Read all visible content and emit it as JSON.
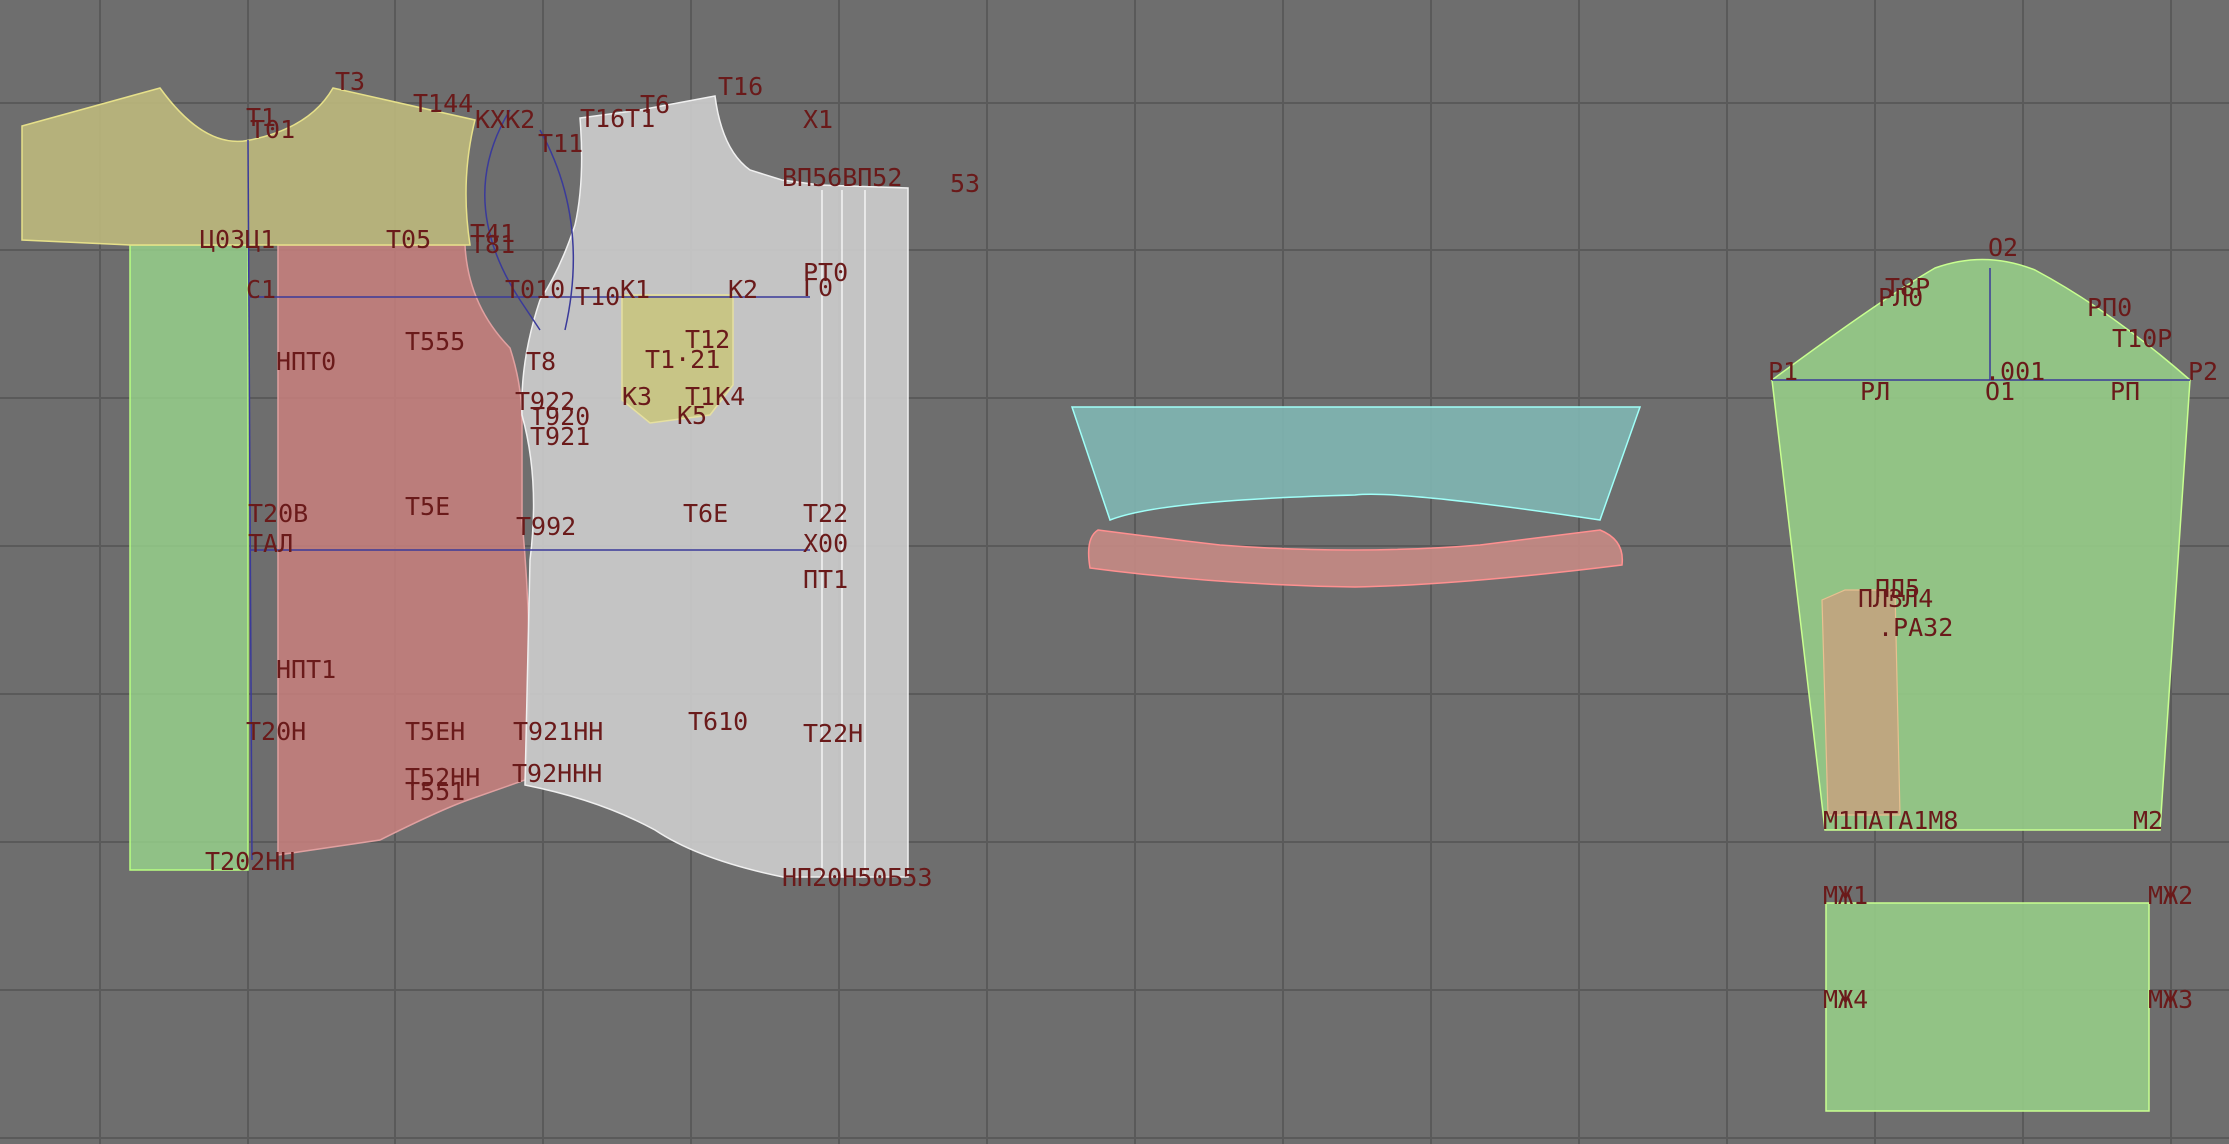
{
  "viewer": {
    "background": "#6e6e6e",
    "grid_color": "#5a5a5a",
    "pattern_colors": {
      "front_panel": "#c8c8c8",
      "side_panel": "#c9807e",
      "back_panel": "#98d68c",
      "yoke": "#bcb87c",
      "pocket": "#c9c57f",
      "collar_stand": "#7fb6b2",
      "collar_band": "#c58a84",
      "sleeve": "#94c786",
      "sleeve_placket": "#c9a07e",
      "cuff": "#94c786",
      "construction_line": "#3a3a9a",
      "label": "#6a1a1a"
    }
  },
  "labels": {
    "t3": "T3",
    "t1": "T1",
    "t01": "T01",
    "t44": "T144",
    "kk2": "KXK2",
    "t1611": "T16T1",
    "t6": "T6",
    "t16": "T16",
    "x1": "X1",
    "t11": "T11",
    "vp": "ВП56ВП52",
    "vp53": "53",
    "c03": "Ц03Ц1",
    "t05": "T05",
    "t41": "T41",
    "t81": "T81",
    "rt0": "РТ0",
    "c1": "C1",
    "t010": "T010",
    "t10": "T10",
    "k1": "K1",
    "k2": "K2",
    "g0": "Г0",
    "npt0": "НПТ0",
    "t555": "T555",
    "t12": "T12",
    "t8": "T8",
    "t121": "T1·21",
    "k3": "K3",
    "t1k4": "T1K4",
    "t922": "T922",
    "t920": "T920",
    "k5": "K5",
    "t921": "T921",
    "t20v": "T20B",
    "t5e": "T5E",
    "t992": "T992",
    "t6e": "T6E",
    "t22": "T22",
    "tal": "TAЛ",
    "x00": "X00",
    "pt1": "ПТ1",
    "npt1": "НПТ1",
    "t610": "T610",
    "t20n": "T20H",
    "t5en": "T5EH",
    "t921n": "T921HH",
    "t22n": "T22H",
    "t52nn": "T52HH",
    "t92nn": "T92HHH",
    "t551": "T551",
    "t202nn": "T202HH",
    "np": "НП20Н50Б53",
    "o2": "O2",
    "r8p": "T8P",
    "r10": "РЛ0",
    "rp0": "РП0",
    "t10r": "T10P",
    "r1": "P1",
    "rl": "РЛ",
    "o01": ".001",
    "o1": "O1",
    "rp": "РП",
    "r2": "P2",
    "pd5": "ПД5",
    "ppl4": "ПЛЗЛ4",
    "ra32": ".РА32",
    "m1": "M1ПАТА1М8",
    "m2": "M2",
    "mj1": "MЖ1",
    "mj2": "MЖ2",
    "mj4": "MЖ4",
    "mj3": "MЖ3"
  }
}
